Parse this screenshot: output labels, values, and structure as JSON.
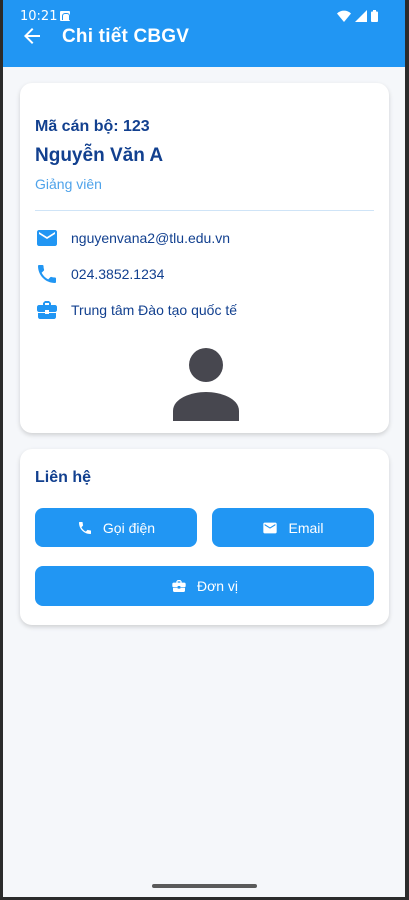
{
  "status_bar": {
    "time": "10:21"
  },
  "appbar": {
    "title": "Chi tiết CBGV"
  },
  "profile": {
    "staff_id": "Mã cán bộ: 123",
    "name": "Nguyễn Văn A",
    "role": "Giảng viên",
    "email": "nguyenvana2@tlu.edu.vn",
    "phone": "024.3852.1234",
    "unit": "Trung tâm Đào tạo quốc tế"
  },
  "contact": {
    "title": "Liên hệ",
    "call_label": "Gọi điện",
    "email_label": "Email",
    "unit_label": "Đơn vị"
  },
  "icons": {
    "back": "arrow-back-icon",
    "email": "email-icon",
    "phone": "phone-icon",
    "unit": "briefcase-icon",
    "avatar": "person-icon"
  },
  "colors": {
    "primary": "#2196f3",
    "text_dark_blue": "#12408f",
    "role_text": "#4fa3ea",
    "avatar": "#47474f"
  }
}
